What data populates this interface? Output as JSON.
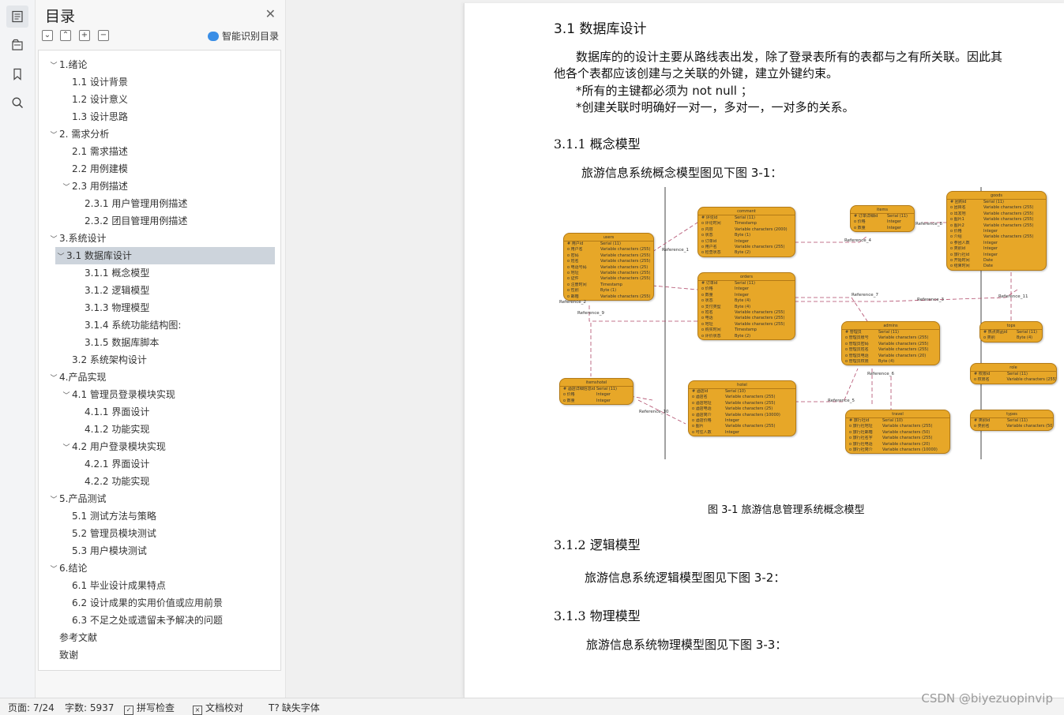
{
  "toc": {
    "title": "目录",
    "smart_label": "智能识别目录",
    "items": [
      {
        "label": "1.绪论",
        "level": 0,
        "caret": true,
        "sel": false
      },
      {
        "label": "1.1 设计背景",
        "level": 1,
        "caret": false,
        "sel": false
      },
      {
        "label": "1.2 设计意义",
        "level": 1,
        "caret": false,
        "sel": false
      },
      {
        "label": "1.3 设计思路",
        "level": 1,
        "caret": false,
        "sel": false
      },
      {
        "label": "2. 需求分析",
        "level": 0,
        "caret": true,
        "sel": false
      },
      {
        "label": "2.1  需求描述",
        "level": 1,
        "caret": false,
        "sel": false
      },
      {
        "label": "2.2  用例建模",
        "level": 1,
        "caret": false,
        "sel": false
      },
      {
        "label": "2.3  用例描述",
        "level": 1,
        "caret": true,
        "sel": false
      },
      {
        "label": "2.3.1  用户管理用例描述",
        "level": 2,
        "caret": false,
        "sel": false
      },
      {
        "label": "2.3.2  团目管理用例描述",
        "level": 2,
        "caret": false,
        "sel": false
      },
      {
        "label": "3.系统设计",
        "level": 0,
        "caret": true,
        "sel": false
      },
      {
        "label": "3.1  数据库设计",
        "level": 1,
        "caret": true,
        "sel": true
      },
      {
        "label": "3.1.1  概念模型",
        "level": 2,
        "caret": false,
        "sel": false
      },
      {
        "label": "3.1.2  逻辑模型",
        "level": 2,
        "caret": false,
        "sel": false
      },
      {
        "label": "3.1.3  物理模型",
        "level": 2,
        "caret": false,
        "sel": false
      },
      {
        "label": "3.1.4  系统功能结构图:",
        "level": 2,
        "caret": false,
        "sel": false
      },
      {
        "label": "3.1.5  数据库脚本",
        "level": 2,
        "caret": false,
        "sel": false
      },
      {
        "label": "3.2  系统架构设计",
        "level": 1,
        "caret": false,
        "sel": false
      },
      {
        "label": "4.产品实现",
        "level": 0,
        "caret": true,
        "sel": false
      },
      {
        "label": "4.1  管理员登录模块实现",
        "level": 1,
        "caret": true,
        "sel": false
      },
      {
        "label": "4.1.1  界面设计",
        "level": 2,
        "caret": false,
        "sel": false
      },
      {
        "label": "4.1.2  功能实现",
        "level": 2,
        "caret": false,
        "sel": false
      },
      {
        "label": "4.2  用户登录模块实现",
        "level": 1,
        "caret": true,
        "sel": false
      },
      {
        "label": "4.2.1  界面设计",
        "level": 2,
        "caret": false,
        "sel": false
      },
      {
        "label": "4.2.2  功能实现",
        "level": 2,
        "caret": false,
        "sel": false
      },
      {
        "label": "5.产品测试",
        "level": 0,
        "caret": true,
        "sel": false
      },
      {
        "label": "5.1  测试方法与策略",
        "level": 1,
        "caret": false,
        "sel": false
      },
      {
        "label": "5.2 管理员模块测试",
        "level": 1,
        "caret": false,
        "sel": false
      },
      {
        "label": "5.3  用户模块测试",
        "level": 1,
        "caret": false,
        "sel": false
      },
      {
        "label": "6.结论",
        "level": 0,
        "caret": true,
        "sel": false
      },
      {
        "label": "6.1 毕业设计成果特点",
        "level": 1,
        "caret": false,
        "sel": false
      },
      {
        "label": "6.2 设计成果的实用价值或应用前景",
        "level": 1,
        "caret": false,
        "sel": false
      },
      {
        "label": "6.3 不足之处或遗留未予解决的问题",
        "level": 1,
        "caret": false,
        "sel": false
      },
      {
        "label": "参考文献",
        "level": 0,
        "caret": false,
        "sel": false
      },
      {
        "label": "致谢",
        "level": 0,
        "caret": false,
        "sel": false
      }
    ]
  },
  "doc": {
    "h_3_1": "3.1  数据库设计",
    "p1_line1": "数据库的的设计主要从路线表出发，除了登录表所有的表都与之有所关联。因此其",
    "p1_line2": "他各个表都应该创建与之关联的外键，建立外键约束。",
    "p2": "*所有的主键都必须为  not null ；",
    "p3": "*创建关联时明确好一对一，多对一，一对多的关系。",
    "h_3_1_1": "3.1.1  概念模型",
    "p_concept": "旅游信息系统概念模型图见下图 3-1：",
    "caption": "图 3-1  旅游信息管理系统概念模型",
    "h_3_1_2": "3.1.2  逻辑模型",
    "p_logic": "旅游信息系统逻辑模型图见下图 3-2：",
    "h_3_1_3": "3.1.3  物理模型",
    "p_phys": "旅游信息系统物理模型图见下图 3-3："
  },
  "diagram": {
    "entities": [
      {
        "id": "users",
        "title": "users",
        "rows": [
          [
            "用户id",
            "Serial (11)"
          ],
          [
            "用户名",
            "Variable characters (255)"
          ],
          [
            "密码",
            "Variable characters (255)"
          ],
          [
            "姓名",
            "Variable characters (255)"
          ],
          [
            "电话号码",
            "Variable characters (25)"
          ],
          [
            "地址",
            "Variable characters (255)"
          ],
          [
            "证件",
            "Variable characters (255)"
          ],
          [
            "注册时间",
            "Timestamp"
          ],
          [
            "性别",
            "Byte (1)"
          ],
          [
            "邮箱",
            "Variable characters (255)"
          ]
        ]
      },
      {
        "id": "comment",
        "title": "comment",
        "rows": [
          [
            "评论id",
            "Serial (11)"
          ],
          [
            "评论时间",
            "Timestamp"
          ],
          [
            "内容",
            "Variable characters (2000)"
          ],
          [
            "状态",
            "Byte (1)"
          ],
          [
            "订单id",
            "Integer"
          ],
          [
            "用户名",
            "Variable characters (255)"
          ],
          [
            "检查状态",
            "Byte (2)"
          ]
        ]
      },
      {
        "id": "items",
        "title": "items",
        "rows": [
          [
            "订单详细id",
            "Serial (11)"
          ],
          [
            "价格",
            "Integer"
          ],
          [
            "数量",
            "Integer"
          ]
        ]
      },
      {
        "id": "goods",
        "title": "goods",
        "rows": [
          [
            "团购id",
            "Serial (11)"
          ],
          [
            "团目名",
            "Variable characters (255)"
          ],
          [
            "出发地",
            "Variable characters (255)"
          ],
          [
            "图片1",
            "Variable characters (255)"
          ],
          [
            "图片2",
            "Variable characters (255)"
          ],
          [
            "价格",
            "Integer"
          ],
          [
            "介绍",
            "Variable characters (255)"
          ],
          [
            "参团人数",
            "Integer"
          ],
          [
            "类别id",
            "Integer"
          ],
          [
            "旅行社id",
            "Integer"
          ],
          [
            "开始时间",
            "Date"
          ],
          [
            "结束时间",
            "Date"
          ]
        ]
      },
      {
        "id": "orders",
        "title": "orders",
        "rows": [
          [
            "订单id",
            "Serial (11)"
          ],
          [
            "价格",
            "Integer"
          ],
          [
            "数量",
            "Integer"
          ],
          [
            "状态",
            "Byte (4)"
          ],
          [
            "支付类型",
            "Byte (4)"
          ],
          [
            "姓名",
            "Variable characters (255)"
          ],
          [
            "电话",
            "Variable characters (255)"
          ],
          [
            "地址",
            "Variable characters (255)"
          ],
          [
            "购买时间",
            "Timestamp"
          ],
          [
            "评价状态",
            "Byte (2)"
          ]
        ]
      },
      {
        "id": "admins",
        "title": "admins",
        "rows": [
          [
            "管理员",
            "Serial (11)"
          ],
          [
            "管理员账号",
            "Variable characters (255)"
          ],
          [
            "管理员密码",
            "Variable characters (255)"
          ],
          [
            "管理员姓名",
            "Variable characters (255)"
          ],
          [
            "管理员电话",
            "Variable characters (20)"
          ],
          [
            "管理员权限",
            "Byte (4)"
          ]
        ]
      },
      {
        "id": "tops",
        "title": "tops",
        "rows": [
          [
            "热点商品id",
            "Serial (11)"
          ],
          [
            "类别",
            "Byte (4)"
          ]
        ]
      },
      {
        "id": "role",
        "title": "role",
        "rows": [
          [
            "权限id",
            "Serial (11)"
          ],
          [
            "权限名",
            "Variable characters (255)"
          ]
        ]
      },
      {
        "id": "itemshotel",
        "title": "itemshotel",
        "rows": [
          [
            "酒店详细信息id",
            "Serial (11)"
          ],
          [
            "价格",
            "Integer"
          ],
          [
            "数量",
            "Integer"
          ]
        ]
      },
      {
        "id": "hotel",
        "title": "hotel",
        "rows": [
          [
            "酒店id",
            "Serial (10)"
          ],
          [
            "酒店名",
            "Variable characters (255)"
          ],
          [
            "酒店地址",
            "Variable characters (255)"
          ],
          [
            "酒店电话",
            "Variable characters (25)"
          ],
          [
            "酒店简介",
            "Variable characters (10000)"
          ],
          [
            "酒店价格",
            "Integer"
          ],
          [
            "图片",
            "Variable characters (255)"
          ],
          [
            "可住人数",
            "Integer"
          ]
        ]
      },
      {
        "id": "travel",
        "title": "travel",
        "rows": [
          [
            "旅行社id",
            "Serial (10)"
          ],
          [
            "旅行社地址",
            "Variable characters (255)"
          ],
          [
            "旅行社邮箱",
            "Variable characters (50)"
          ],
          [
            "旅行社名字",
            "Variable characters (255)"
          ],
          [
            "旅行社电话",
            "Variable characters (20)"
          ],
          [
            "旅行社简介",
            "Variable characters (10000)"
          ]
        ]
      },
      {
        "id": "types",
        "title": "types",
        "rows": [
          [
            "类别id",
            "Serial (11)"
          ],
          [
            "类别名",
            "Variable characters (50)"
          ]
        ]
      }
    ],
    "refs": [
      "Reference_1",
      "Reference_2",
      "Reference_9",
      "Reference_4",
      "Reference_8",
      "Reference_7",
      "Reference_3",
      "Reference_11",
      "Reference_6",
      "Reference_5",
      "Reference_10"
    ]
  },
  "status": {
    "page": "页面: 7/24",
    "words": "字数: 5937",
    "spell": "拼写检查",
    "proof": "文档校对",
    "fonts": "缺失字体"
  },
  "watermark": "CSDN @biyezuopinvip"
}
